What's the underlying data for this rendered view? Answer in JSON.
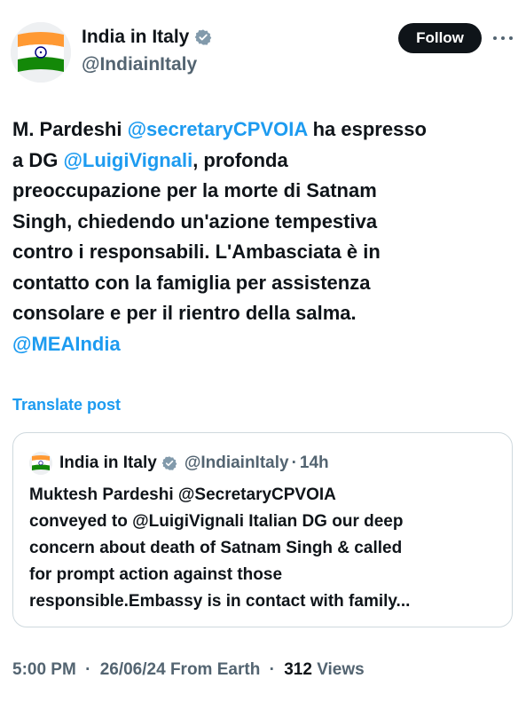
{
  "author": {
    "display_name": "India in Italy",
    "handle": "@IndiainItaly",
    "avatar_icon": "india-flag-icon",
    "verified_icon": "verified-badge-icon"
  },
  "actions": {
    "follow_label": "Follow",
    "more_icon": "more-options-icon"
  },
  "tweet": {
    "lines": [
      [
        {
          "t": "M. Pardeshi "
        },
        {
          "t": "@secretaryCPVOIA",
          "m": true
        },
        {
          "t": " ha espresso"
        }
      ],
      [
        {
          "t": "a DG "
        },
        {
          "t": "@LuigiVignali",
          "m": true
        },
        {
          "t": ", profonda"
        }
      ],
      [
        {
          "t": "preoccupazione per la morte di Satnam"
        }
      ],
      [
        {
          "t": "Singh, chiedendo un'azione tempestiva"
        }
      ],
      [
        {
          "t": "contro i responsabili. L'Ambasciata è in"
        }
      ],
      [
        {
          "t": "contatto con la famiglia per assistenza"
        }
      ],
      [
        {
          "t": "consolare e per il rientro della salma."
        }
      ],
      [
        {
          "t": "@MEAIndia",
          "m": true
        }
      ]
    ],
    "translate_label": "Translate post"
  },
  "quoted": {
    "display_name": "India in Italy",
    "handle": "@IndiainItaly",
    "dot": "·",
    "time": "14h",
    "lines": [
      "Muktesh Pardeshi @SecretaryCPVOIA",
      "conveyed to @LuigiVignali Italian DG our deep",
      "concern about death of Satnam Singh & called",
      "for prompt action against those",
      "responsible.Embassy is in contact with family..."
    ]
  },
  "meta": {
    "time": "5:00 PM",
    "sep1": "·",
    "date": "26/06/24",
    "source": "From Earth",
    "sep2": "·",
    "views_count": "312",
    "views_label": "Views"
  },
  "colors": {
    "link": "#1d9bf0",
    "secondary": "#536471",
    "text": "#0f1419",
    "saffron": "#ff9933",
    "green": "#138808",
    "chakra": "#000080"
  }
}
